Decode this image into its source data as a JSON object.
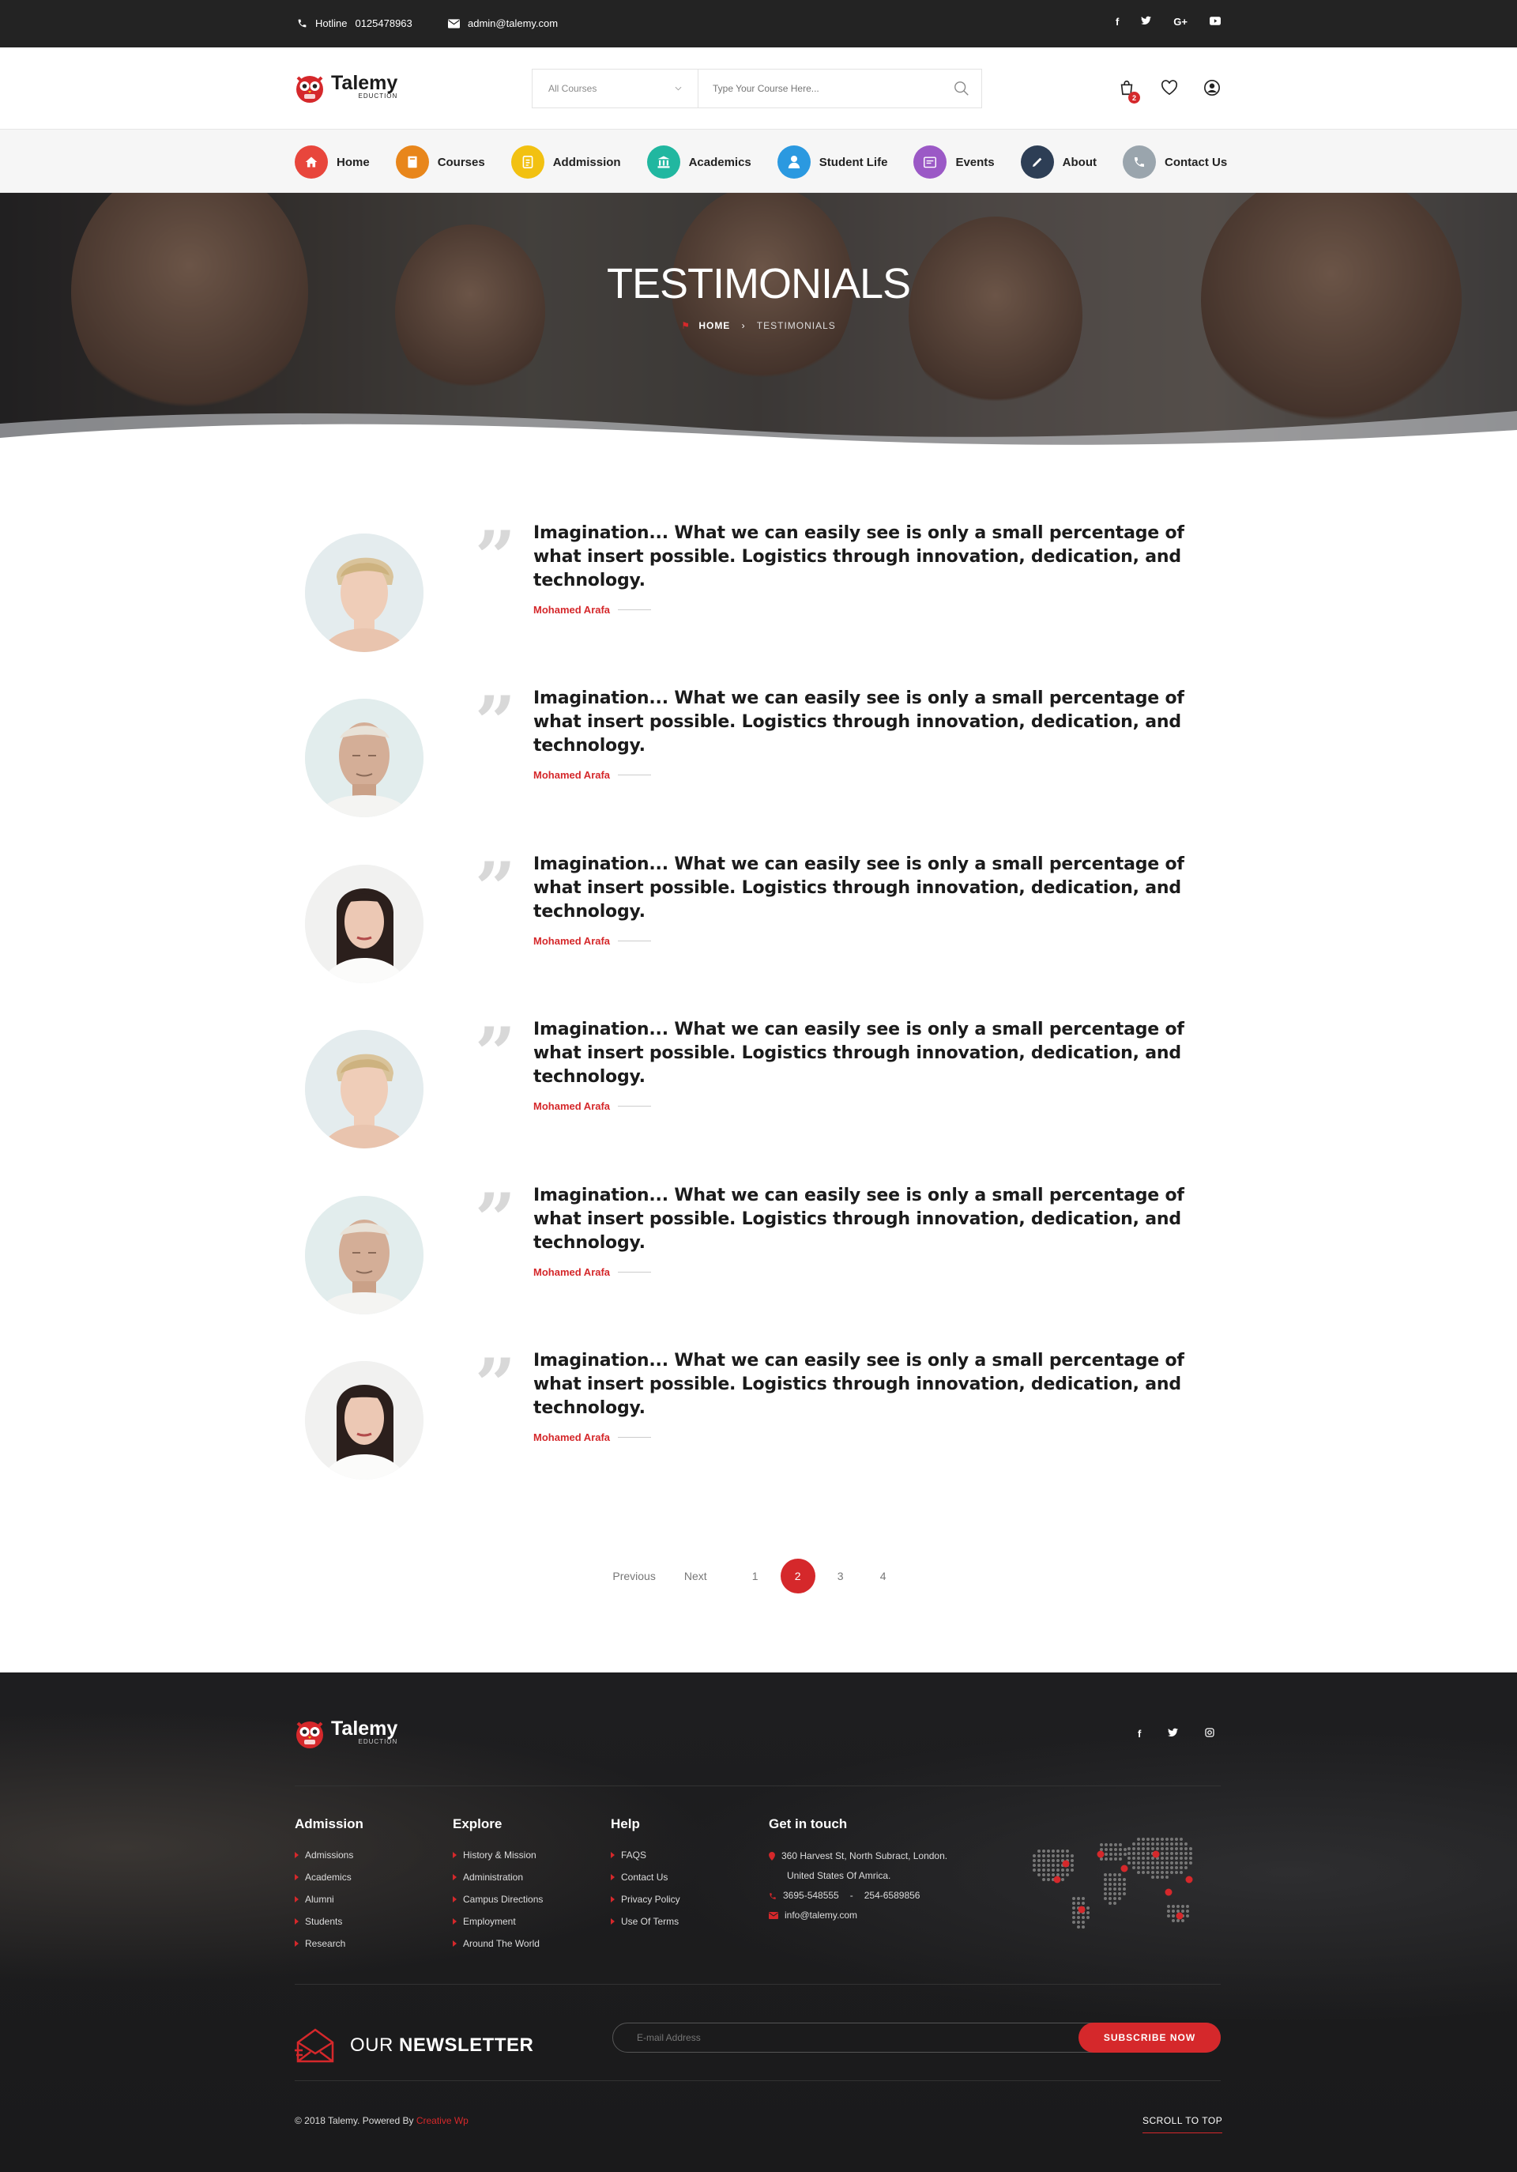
{
  "topbar": {
    "hotline_label": "Hotline",
    "hotline_number": "0125478963",
    "email": "admin@talemy.com",
    "social": [
      "f",
      "t",
      "G+",
      "yt"
    ]
  },
  "brand": {
    "name": "Talemy",
    "tagline": "EDUCTION",
    "accent_color": "#d5282b"
  },
  "search": {
    "category_selected": "All Courses",
    "placeholder": "Type Your Course Here..."
  },
  "header_icons": {
    "cart_count": "2",
    "icons": [
      "cart-icon",
      "heart-icon",
      "user-icon"
    ]
  },
  "nav": {
    "items": [
      {
        "label": "Home",
        "icon": "home-icon",
        "color": "#e8463c"
      },
      {
        "label": "Courses",
        "icon": "book-icon",
        "color": "#e8861b"
      },
      {
        "label": "Addmission",
        "icon": "document-icon",
        "color": "#f2c111"
      },
      {
        "label": "Academics",
        "icon": "bank-icon",
        "color": "#21b7a0"
      },
      {
        "label": "Student Life",
        "icon": "user-icon",
        "color": "#2b99e0"
      },
      {
        "label": "Events",
        "icon": "calendar-icon",
        "color": "#9b59c6"
      },
      {
        "label": "About",
        "icon": "pen-icon",
        "color": "#2d3e55"
      },
      {
        "label": "Contact Us",
        "icon": "phone-icon",
        "color": "#9aa5ad"
      }
    ]
  },
  "hero": {
    "title": "TESTIMONIALS",
    "breadcrumb_home": "HOME",
    "breadcrumb_current": "TESTIMONIALS"
  },
  "testimonials": [
    {
      "text": "Imagination... What we can easily see is only a small percentage of what insert possible. Logistics through innovation, dedication, and technology.",
      "author": "Mohamed Arafa",
      "avatar": "young-man"
    },
    {
      "text": "Imagination... What we can easily see is only a small percentage of what insert possible. Logistics through innovation, dedication, and technology.",
      "author": "Mohamed Arafa",
      "avatar": "old-man"
    },
    {
      "text": "Imagination... What we can easily see is only a small percentage of what insert possible. Logistics through innovation, dedication, and technology.",
      "author": "Mohamed Arafa",
      "avatar": "woman"
    },
    {
      "text": "Imagination... What we can easily see is only a small percentage of what insert possible. Logistics through innovation, dedication, and technology.",
      "author": "Mohamed Arafa",
      "avatar": "young-man"
    },
    {
      "text": "Imagination... What we can easily see is only a small percentage of what insert possible. Logistics through innovation, dedication, and technology.",
      "author": "Mohamed Arafa",
      "avatar": "old-man"
    },
    {
      "text": "Imagination... What we can easily see is only a small percentage of what insert possible. Logistics through innovation, dedication, and technology.",
      "author": "Mohamed Arafa",
      "avatar": "woman"
    }
  ],
  "pagination": {
    "prev": "Previous",
    "next": "Next",
    "pages": [
      "1",
      "2",
      "3",
      "4"
    ],
    "current": "2"
  },
  "footer": {
    "columns": [
      {
        "title": "Admission",
        "links": [
          "Admissions",
          "Academics",
          "Alumni",
          "Students",
          "Research"
        ]
      },
      {
        "title": "Explore",
        "links": [
          "History & Mission",
          "Administration",
          "Campus Directions",
          "Employment",
          "Around The World"
        ]
      },
      {
        "title": "Help",
        "links": [
          "FAQS",
          "Contact Us",
          "Privacy Policy",
          "Use Of Terms"
        ]
      }
    ],
    "contact": {
      "title": "Get in touch",
      "address_line1": "360 Harvest St, North Subract, London.",
      "address_line2": "United States Of Amrica.",
      "phone1": "3695-548555",
      "phone_sep": "-",
      "phone2": "254-6589856",
      "email": "info@talemy.com"
    },
    "newsletter": {
      "title_light": "OUR",
      "title_bold": "NEWSLETTER",
      "placeholder": "E-mail Address",
      "button": "SUBSCRIBE NOW"
    },
    "copyright": "© 2018 Talemy.  Powered By",
    "powered_by": "Creative Wp",
    "scroll_top": "SCROLL TO TOP"
  }
}
